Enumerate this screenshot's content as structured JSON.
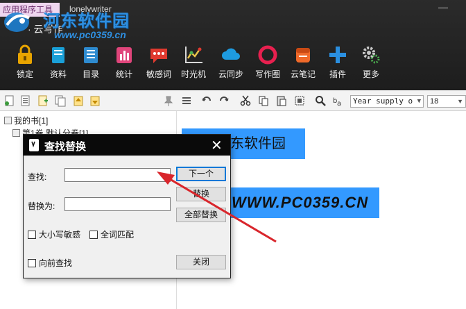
{
  "titlebar": {
    "tools_tab": "应用程序工具",
    "app_name": "lonelywriter",
    "window_title": "· 云写作",
    "minimize": "—"
  },
  "watermark": {
    "site_name": "河东软件园",
    "url": "www.pc0359.cn"
  },
  "ribbon_tools": [
    {
      "label": "锁定",
      "icon": "lock-icon",
      "color": "#e8a400"
    },
    {
      "label": "资料",
      "icon": "book-icon",
      "color": "#1aa0d8"
    },
    {
      "label": "目录",
      "icon": "catalog-icon",
      "color": "#2e8bd0"
    },
    {
      "label": "统计",
      "icon": "stats-icon",
      "color": "#e0457b"
    },
    {
      "label": "敏感词",
      "icon": "chat-icon",
      "color": "#e03a2f"
    },
    {
      "label": "时光机",
      "icon": "chart-icon",
      "color": "#d0d0d0"
    },
    {
      "label": "云同步",
      "icon": "cloud-icon",
      "color": "#1e9be0"
    },
    {
      "label": "写作圈",
      "icon": "ring-icon",
      "color": "#e8204f"
    },
    {
      "label": "云笔记",
      "icon": "note-icon",
      "color": "#f06a2a"
    },
    {
      "label": "插件",
      "icon": "plus-icon",
      "color": "#2a8fe0"
    },
    {
      "label": "更多",
      "icon": "gears-icon",
      "color": "#c8c8c8"
    }
  ],
  "format_toolbar": {
    "font_value": "Year supply o",
    "size_value": "18"
  },
  "tree": {
    "root": "我的书[1]",
    "child": "第1卷 默认分卷[1]"
  },
  "editor": {
    "line1": "东软件园",
    "line2": "WWW.PC0359.CN"
  },
  "dialog": {
    "title": "查找替换",
    "close": "✕",
    "find_label": "查找:",
    "find_value": "",
    "replace_label": "替换为:",
    "replace_value": "",
    "next_button": "下一个",
    "replace_button": "替换",
    "replace_all_button": "全部替换",
    "match_case": "大小写敏感",
    "whole_word": "全词匹配",
    "search_backward": "向前查找",
    "close_button": "关闭"
  },
  "colors": {
    "ribbon_bg": "#1d1d1d",
    "selection": "#3399ff",
    "arrow": "#d9262c",
    "watermark": "#2f8fe0"
  }
}
